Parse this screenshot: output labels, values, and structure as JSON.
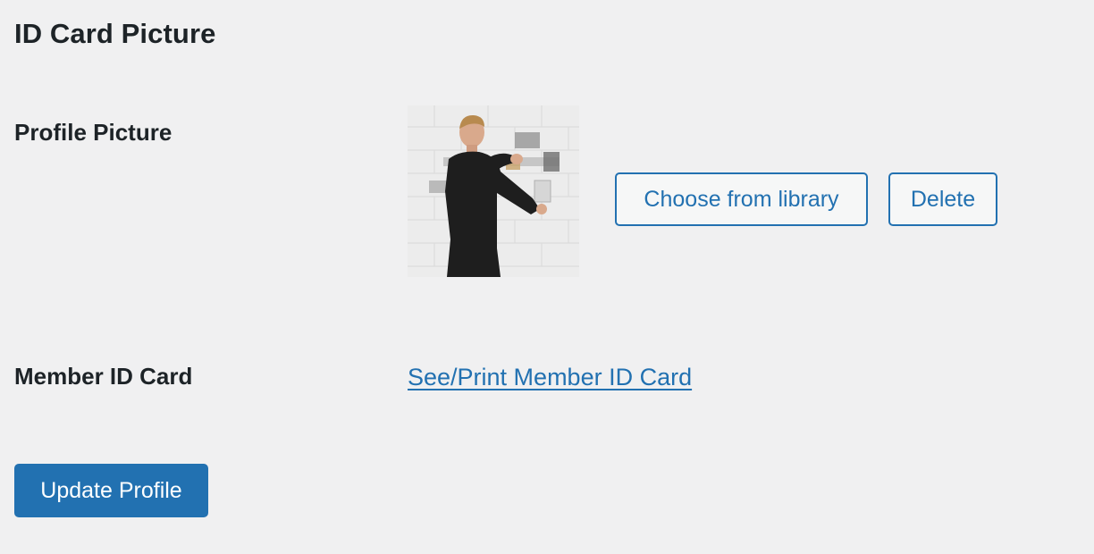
{
  "section": {
    "title": "ID Card Picture"
  },
  "profile_picture": {
    "label": "Profile Picture",
    "image_alt": "profile photo",
    "choose_button_label": "Choose from library",
    "delete_button_label": "Delete"
  },
  "member_id_card": {
    "label": "Member ID Card",
    "link_text": "See/Print Member ID Card"
  },
  "form": {
    "submit_label": "Update Profile"
  },
  "colors": {
    "background": "#f0f0f1",
    "accent": "#2271b1",
    "text": "#1d2327"
  }
}
